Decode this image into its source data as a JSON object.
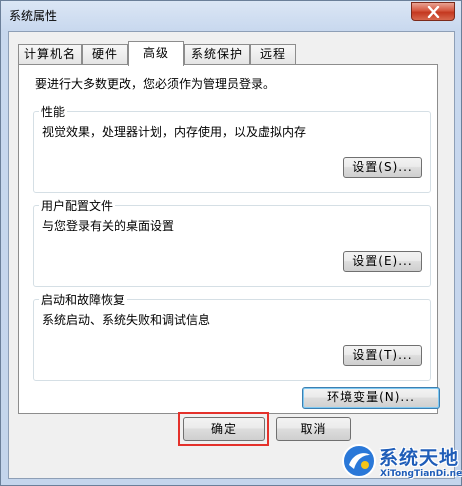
{
  "window": {
    "title": "系统属性"
  },
  "tabs": [
    {
      "label": "计算机名"
    },
    {
      "label": "硬件"
    },
    {
      "label": "高级",
      "active": true
    },
    {
      "label": "系统保护"
    },
    {
      "label": "远程"
    }
  ],
  "panel": {
    "note": "要进行大多数更改，您必须作为管理员登录。",
    "groups": [
      {
        "title": "性能",
        "desc": "视觉效果，处理器计划，内存使用，以及虚拟内存",
        "button": "设置(S)..."
      },
      {
        "title": "用户配置文件",
        "desc": "与您登录有关的桌面设置",
        "button": "设置(E)..."
      },
      {
        "title": "启动和故障恢复",
        "desc": "系统启动、系统失败和调试信息",
        "button": "设置(T)..."
      }
    ],
    "env_button": "环境变量(N)..."
  },
  "footer": {
    "ok": "确定",
    "cancel": "取消"
  },
  "watermark": {
    "title": "系统天地",
    "url": "XiTongTianDi.net"
  },
  "colors": {
    "highlight": "#e4312b",
    "watermark": "#1f5db8"
  }
}
